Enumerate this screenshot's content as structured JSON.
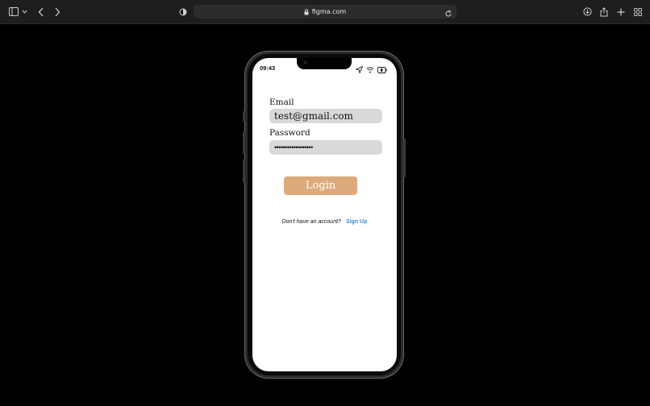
{
  "browser": {
    "url": "figma.com",
    "icons": {
      "sidebar": "sidebar-icon",
      "back": "chevron-left-icon",
      "forward": "chevron-right-icon",
      "privacy": "shield-icon",
      "lock": "lock-icon",
      "reload": "reload-icon",
      "download": "download-icon",
      "share": "share-icon",
      "new_tab": "plus-icon",
      "tabs": "tab-overview-icon"
    }
  },
  "status_bar": {
    "time": "09:43"
  },
  "login_form": {
    "email_label": "Email",
    "email_value": "test@gmail.com",
    "password_label": "Password",
    "password_value": "••••••••••••••••••",
    "login_label": "Login",
    "signup_prompt": "Don't have an account?",
    "signup_link": "Sign Up"
  },
  "colors": {
    "login_button": "#ddaa7c",
    "field_background": "#d9d9d9",
    "signup_link": "#3a8fd6"
  }
}
